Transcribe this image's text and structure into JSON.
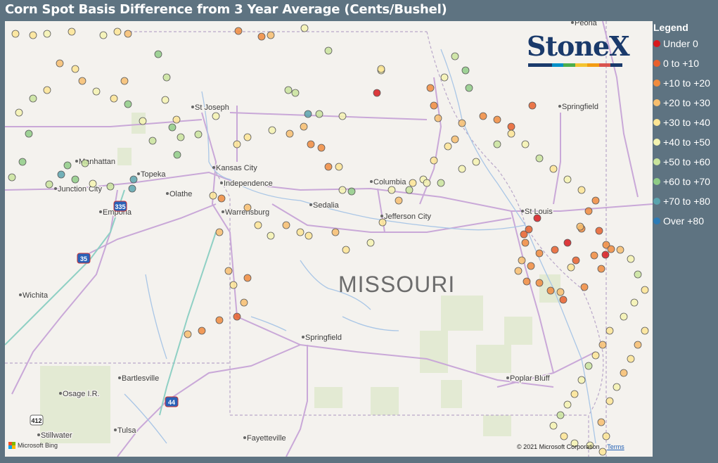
{
  "title": "Corn Spot Basis Difference from 3 Year Average (Cents/Bushel)",
  "legend": {
    "title": "Legend",
    "items": [
      {
        "label": "Under 0",
        "color": "#d7191c"
      },
      {
        "label": "0 to +10",
        "color": "#e8602c"
      },
      {
        "label": "+10 to +20",
        "color": "#f08b3d"
      },
      {
        "label": "+20 to +30",
        "color": "#f7be6e"
      },
      {
        "label": "+30 to +40",
        "color": "#fde594"
      },
      {
        "label": "+40 to +50",
        "color": "#f4f3b0"
      },
      {
        "label": "+50 to +60",
        "color": "#c9e49c"
      },
      {
        "label": "+60 to +70",
        "color": "#8fcc86"
      },
      {
        "label": "+70 to +80",
        "color": "#5aa4ae"
      },
      {
        "label": "Over +80",
        "color": "#2c7bb6"
      }
    ]
  },
  "map": {
    "state_label": "MISSOURI",
    "cities": [
      {
        "name": "St Joseph"
      },
      {
        "name": "Manhattan"
      },
      {
        "name": "Topeka"
      },
      {
        "name": "Kansas City"
      },
      {
        "name": "Independence"
      },
      {
        "name": "Junction City"
      },
      {
        "name": "Olathe"
      },
      {
        "name": "Columbia"
      },
      {
        "name": "Warrensburg"
      },
      {
        "name": "Sedalia"
      },
      {
        "name": "Jefferson City"
      },
      {
        "name": "Emporia"
      },
      {
        "name": "St Louis"
      },
      {
        "name": "Springfield"
      },
      {
        "name": "Wichita"
      },
      {
        "name": "Springfield"
      },
      {
        "name": "Bartlesville"
      },
      {
        "name": "Poplar Bluff"
      },
      {
        "name": "Osage I.R."
      },
      {
        "name": "Stillwater"
      },
      {
        "name": "Tulsa"
      },
      {
        "name": "Fayetteville"
      },
      {
        "name": "Peoria"
      }
    ],
    "highways": [
      "335",
      "35",
      "44",
      "412"
    ],
    "points": [
      {
        "cat": 4
      },
      {
        "cat": 4
      },
      {
        "cat": 5
      },
      {
        "cat": 4
      },
      {
        "cat": 5
      },
      {
        "cat": 4
      },
      {
        "cat": 3
      },
      {
        "cat": 2
      },
      {
        "cat": 3
      },
      {
        "cat": 2
      },
      {
        "cat": 5
      },
      {
        "cat": 6
      },
      {
        "cat": 5
      },
      {
        "cat": 6
      },
      {
        "cat": 6
      },
      {
        "cat": 8
      },
      {
        "cat": 6
      },
      {
        "cat": 5
      },
      {
        "cat": 0
      },
      {
        "cat": 4
      },
      {
        "cat": 2
      },
      {
        "cat": 2
      },
      {
        "cat": 3
      },
      {
        "cat": 5
      },
      {
        "cat": 6
      },
      {
        "cat": 7
      },
      {
        "cat": 7
      },
      {
        "cat": 8
      },
      {
        "cat": 7
      },
      {
        "cat": 6
      },
      {
        "cat": 5
      },
      {
        "cat": 4
      },
      {
        "cat": 6
      },
      {
        "cat": 7
      },
      {
        "cat": 6
      },
      {
        "cat": 5
      },
      {
        "cat": 7
      },
      {
        "cat": 8
      },
      {
        "cat": 6
      },
      {
        "cat": 5
      },
      {
        "cat": 6
      },
      {
        "cat": 7
      },
      {
        "cat": 7
      },
      {
        "cat": 8
      },
      {
        "cat": 6
      },
      {
        "cat": 7
      },
      {
        "cat": 7
      },
      {
        "cat": 6
      },
      {
        "cat": 5
      },
      {
        "cat": 6
      },
      {
        "cat": 4
      },
      {
        "cat": 3
      },
      {
        "cat": 4
      },
      {
        "cat": 3
      },
      {
        "cat": 5
      },
      {
        "cat": 4
      },
      {
        "cat": 3
      },
      {
        "cat": 7
      },
      {
        "cat": 6
      },
      {
        "cat": 5
      },
      {
        "cat": 4
      },
      {
        "cat": 4
      },
      {
        "cat": 5
      },
      {
        "cat": 3
      },
      {
        "cat": 3
      },
      {
        "cat": 2
      },
      {
        "cat": 2
      },
      {
        "cat": 2
      },
      {
        "cat": 4
      },
      {
        "cat": 5
      },
      {
        "cat": 7
      },
      {
        "cat": 5
      },
      {
        "cat": 6
      },
      {
        "cat": 5
      },
      {
        "cat": 4
      },
      {
        "cat": 4
      },
      {
        "cat": 3
      },
      {
        "cat": 3
      },
      {
        "cat": 2
      },
      {
        "cat": 2
      },
      {
        "cat": 1
      },
      {
        "cat": 1
      },
      {
        "cat": 0
      },
      {
        "cat": 1
      },
      {
        "cat": 2
      },
      {
        "cat": 1
      },
      {
        "cat": 2
      },
      {
        "cat": 1
      },
      {
        "cat": 0
      },
      {
        "cat": 1
      },
      {
        "cat": 2
      },
      {
        "cat": 2
      },
      {
        "cat": 2
      },
      {
        "cat": 1
      },
      {
        "cat": 2
      },
      {
        "cat": 2
      },
      {
        "cat": 3
      },
      {
        "cat": 4
      },
      {
        "cat": 3
      },
      {
        "cat": 2
      },
      {
        "cat": 2
      },
      {
        "cat": 3
      },
      {
        "cat": 3
      },
      {
        "cat": 2
      },
      {
        "cat": 2
      },
      {
        "cat": 1
      },
      {
        "cat": 2
      },
      {
        "cat": 2
      },
      {
        "cat": 0
      },
      {
        "cat": 2
      },
      {
        "cat": 3
      },
      {
        "cat": 5
      },
      {
        "cat": 6
      },
      {
        "cat": 4
      },
      {
        "cat": 5
      },
      {
        "cat": 5
      },
      {
        "cat": 4
      },
      {
        "cat": 3
      },
      {
        "cat": 4
      },
      {
        "cat": 6
      },
      {
        "cat": 5
      },
      {
        "cat": 4
      },
      {
        "cat": 5
      },
      {
        "cat": 6
      },
      {
        "cat": 5
      },
      {
        "cat": 4
      },
      {
        "cat": 5
      },
      {
        "cat": 5
      },
      {
        "cat": 4
      },
      {
        "cat": 4
      },
      {
        "cat": 3
      },
      {
        "cat": 4
      },
      {
        "cat": 5
      },
      {
        "cat": 3
      },
      {
        "cat": 4
      },
      {
        "cat": 3
      },
      {
        "cat": 4
      },
      {
        "cat": 3
      },
      {
        "cat": 2
      },
      {
        "cat": 2
      },
      {
        "cat": 1
      },
      {
        "cat": 3
      },
      {
        "cat": 2
      },
      {
        "cat": 4
      },
      {
        "cat": 3
      },
      {
        "cat": 3
      },
      {
        "cat": 2
      },
      {
        "cat": 4
      },
      {
        "cat": 3
      },
      {
        "cat": 4
      },
      {
        "cat": 5
      },
      {
        "cat": 3
      },
      {
        "cat": 4
      },
      {
        "cat": 4
      },
      {
        "cat": 3
      },
      {
        "cat": 4
      },
      {
        "cat": 5
      },
      {
        "cat": 4
      },
      {
        "cat": 3
      },
      {
        "cat": 4
      },
      {
        "cat": 5
      },
      {
        "cat": 6
      },
      {
        "cat": 5
      },
      {
        "cat": 5
      },
      {
        "cat": 6
      },
      {
        "cat": 4
      },
      {
        "cat": 5
      },
      {
        "cat": 6
      },
      {
        "cat": 4
      },
      {
        "cat": 5
      },
      {
        "cat": 4
      },
      {
        "cat": 4
      },
      {
        "cat": 3
      },
      {
        "cat": 4
      },
      {
        "cat": 5
      },
      {
        "cat": 4
      },
      {
        "cat": 3
      },
      {
        "cat": 4
      },
      {
        "cat": 3
      },
      {
        "cat": 4
      }
    ]
  },
  "logo": {
    "text": "StoneX",
    "tm": "TM"
  },
  "attribution": {
    "left": "Microsoft Bing",
    "right": "© 2021 Microsoft Corporation",
    "terms": "Terms"
  }
}
